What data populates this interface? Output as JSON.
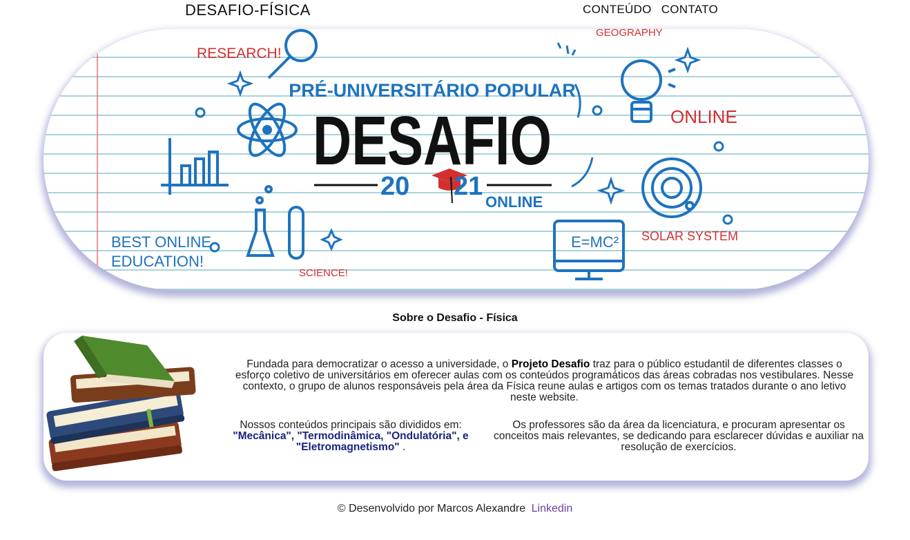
{
  "header": {
    "title": "DESAFIO-FÍSICA",
    "nav": [
      "CONTEÚDO",
      "CONTATO"
    ]
  },
  "banner": {
    "subtitle": "PRÉ-UNIVERSITÁRIO POPULAR",
    "title": "DESAFIO",
    "year_left": "20",
    "year_right": "21",
    "online": "ONLINE",
    "research": "RESEARCH!",
    "geography": "GEOGRAPHY",
    "online_red": "ONLINE",
    "best_online": "BEST ONLINE",
    "education": "EDUCATION!",
    "science": "SCIENCE!",
    "solar_system": "SOLAR SYSTEM",
    "formula": "E=MC²"
  },
  "about": {
    "heading": "Sobre o Desafio - Física",
    "intro_before": "Fundada para democratizar o acesso a universidade, o ",
    "intro_bold": "Projeto Desafio",
    "intro_after": " traz para o público estudantil de diferentes classes o esforço coletivo de universitários em oferecer aulas com os conteúdos programáticos das áreas cobradas nos vestibulares. Nesse contexto, o grupo de alunos responsáveis pela área da Física reune aulas e artigos com os temas tratados durante o ano letivo neste website.",
    "contents_intro": "Nossos conteúdos principais são divididos em:",
    "contents_topics": "\"Mecânica\", \"Termodinâmica, \"Ondulatória\", e \"Eletromagnetismo\"",
    "contents_end": " .",
    "teachers": "Os professores são da área da licenciatura, e procuram apresentar os conceitos mais relevantes, se dedicando para esclarecer dúvidas e auxiliar na resolução de exercícios."
  },
  "footer": {
    "text": "© Desenvolvido por Marcos Alexandre",
    "link": "Linkedin"
  }
}
